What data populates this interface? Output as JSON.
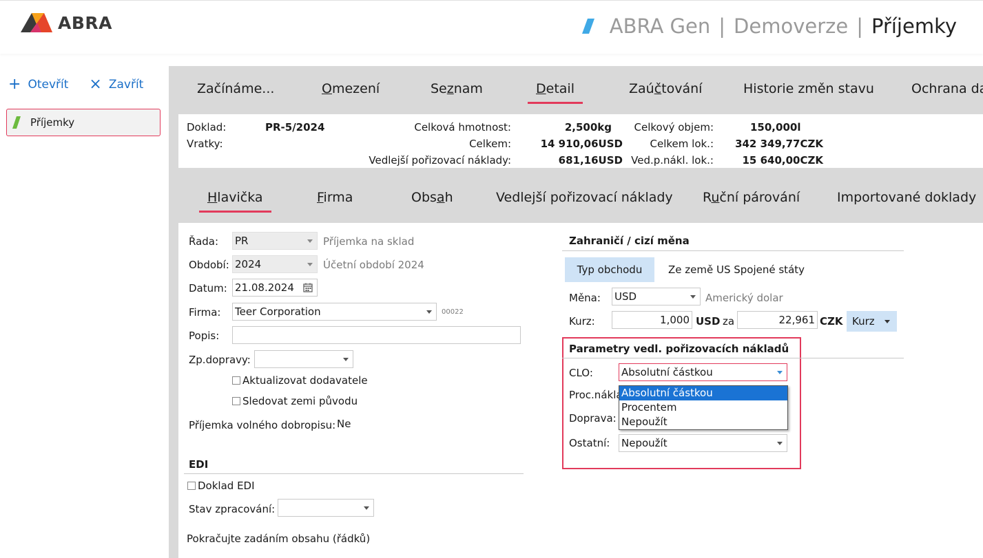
{
  "header": {
    "logo_text": "ABRA",
    "title_parts": [
      "ABRA Gen",
      "Demoverze",
      "Příjemky"
    ],
    "separator": "|"
  },
  "sidebar": {
    "open_icon": "+",
    "open_label": "Otevřít",
    "close_icon": "×",
    "close_label": "Zavřít",
    "active_item": "Příjemky"
  },
  "top_tabs": [
    {
      "pre": "Začínáme",
      "u": "",
      "post": "...",
      "active": false
    },
    {
      "pre": "",
      "u": "O",
      "post": "mezení",
      "active": false
    },
    {
      "pre": "Se",
      "u": "z",
      "post": "nam",
      "active": false
    },
    {
      "pre": "",
      "u": "D",
      "post": "etail",
      "active": true
    },
    {
      "pre": "Zaú",
      "u": "č",
      "post": "tování",
      "active": false
    },
    {
      "pre": "Historie změn stavu",
      "u": "",
      "post": "",
      "active": false
    },
    {
      "pre": "Ochrana da",
      "u": "",
      "post": "",
      "active": false
    }
  ],
  "info": {
    "doklad_label": "Doklad:",
    "doklad_value": "PR-5/2024",
    "vratky_label": "Vratky:",
    "hmotnost_label": "Celková hmotnost:",
    "hmotnost_value": "2,500kg",
    "celkem_label": "Celkem:",
    "celkem_value": "14 910,06USD",
    "vedl_label": "Vedlejší pořizovací náklady:",
    "vedl_value": "681,16USD",
    "objem_label": "Celkový objem:",
    "objem_value": "150,000l",
    "celkem_lok_label": "Celkem lok.:",
    "celkem_lok_value": "342 349,77CZK",
    "vedl_lok_label": "Ved.p.nákl. lok.:",
    "vedl_lok_value": "15 640,00CZK"
  },
  "sub_tabs": [
    {
      "pre": "",
      "u": "H",
      "post": "lavička",
      "active": true
    },
    {
      "pre": "",
      "u": "F",
      "post": "irma",
      "active": false
    },
    {
      "pre": "Obs",
      "u": "a",
      "post": "h",
      "active": false
    },
    {
      "pre": "Vedlejší pořizovací náklady",
      "u": "",
      "post": "",
      "active": false
    },
    {
      "pre": "R",
      "u": "u",
      "post": "ční párování",
      "active": false
    },
    {
      "pre": "Importované doklady",
      "u": "",
      "post": "",
      "active": false
    }
  ],
  "form": {
    "rada_label": "Řada:",
    "rada_value": "PR",
    "rada_desc": "Příjemka na sklad",
    "obdobi_label": "Období:",
    "obdobi_value": "2024",
    "obdobi_desc": "Účetní období 2024",
    "datum_label": "Datum:",
    "datum_value": "21.08.2024",
    "firma_label": "Firma:",
    "firma_value": "Teer Corporation",
    "firma_code": "00022",
    "popis_label": "Popis:",
    "popis_value": "",
    "zpdopravy_label": "Zp.dopravy:",
    "zpdopravy_value": "",
    "aktualizovat_label": "Aktualizovat dodavatele",
    "sledovat_label": "Sledovat zemi původu",
    "dobropis_label": "Příjemka volného dobropisu:",
    "dobropis_value": "Ne"
  },
  "edi": {
    "title": "EDI",
    "doklad_edi_label": "Doklad EDI",
    "stav_label": "Stav zpracování:",
    "stav_value": "",
    "hint": "Pokračujte zadáním obsahu (řádků)"
  },
  "foreign": {
    "title": "Zahraničí / cizí měna",
    "typ_button": "Typ obchodu",
    "zeme_text": "Ze země US Spojené státy",
    "mena_label": "Měna:",
    "mena_value": "USD",
    "mena_desc": "Americký dolar",
    "kurz_label": "Kurz:",
    "kurz_value1": "1,000",
    "kurz_cur1": "USD",
    "kurz_za": "za",
    "kurz_value2": "22,961",
    "kurz_cur2": "CZK",
    "kurz_button": "Kurz"
  },
  "params": {
    "title": "Parametry vedl. pořizovacích nákladů",
    "clo_label": "CLO:",
    "clo_value": "Absolutní částkou",
    "proc_label": "Proc.nákla",
    "doprava_label": "Doprava:",
    "ostatni_label": "Ostatní:",
    "ostatni_value": "Nepoužít",
    "dropdown_options": [
      "Absolutní částkou",
      "Procentem",
      "Nepoužít"
    ],
    "dropdown_selected": 0
  },
  "colors": {
    "accent": "#e23a5b",
    "link": "#1a6fc8",
    "button_bg": "#cfe3f6",
    "selection": "#1a73d4"
  }
}
